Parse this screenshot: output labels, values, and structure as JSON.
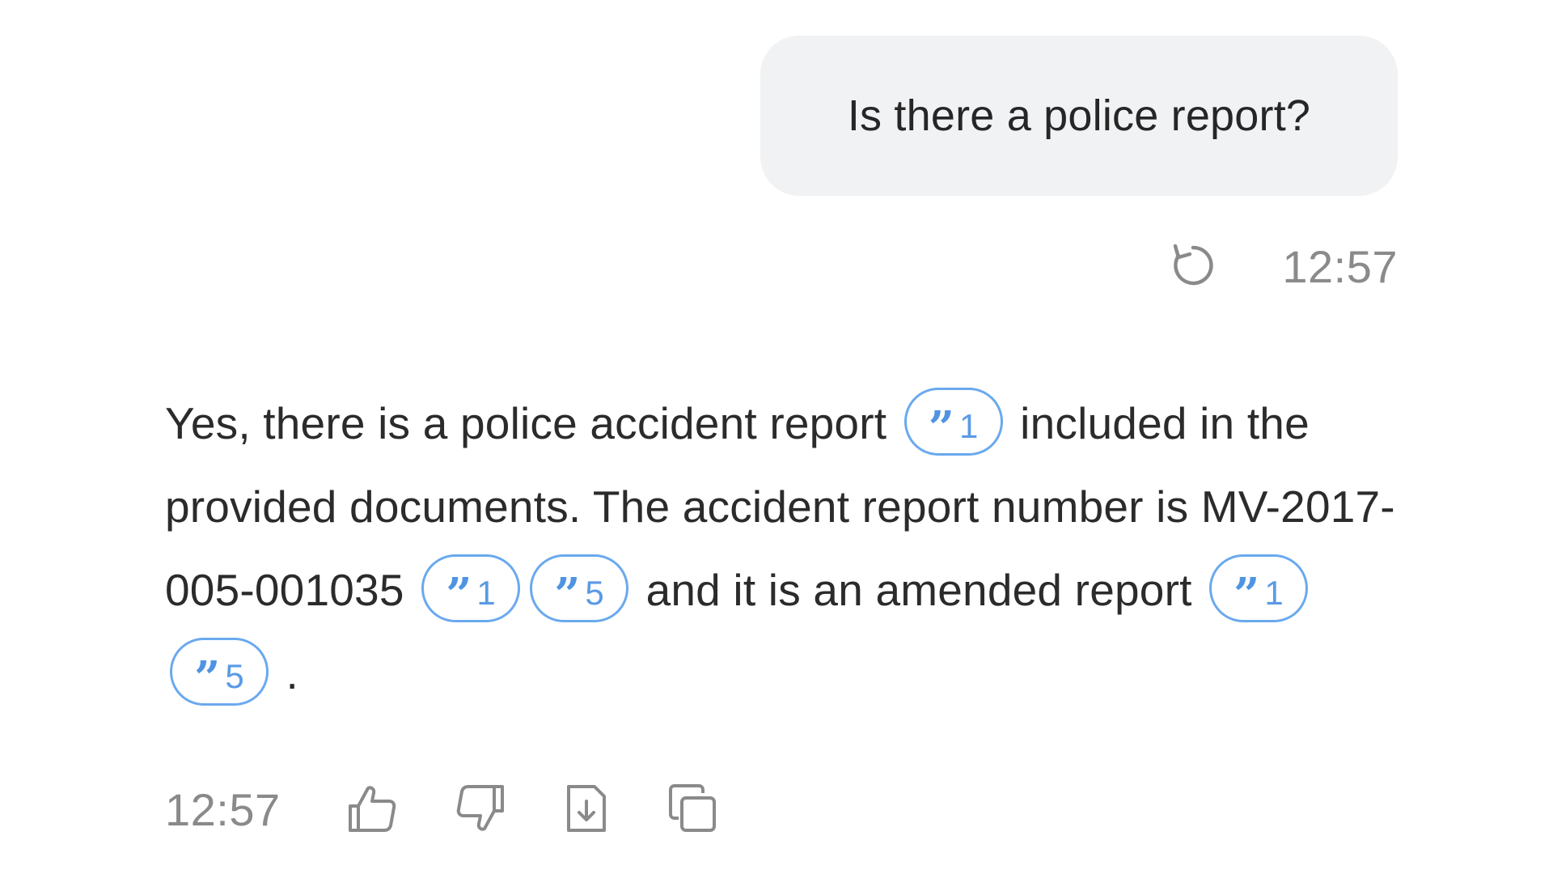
{
  "user_message": {
    "text": "Is there a police report?",
    "time": "12:57",
    "retry_icon": "retry-icon"
  },
  "assistant_message": {
    "segments": [
      {
        "type": "text",
        "value": "Yes, there is a police accident report "
      },
      {
        "type": "cite",
        "value": "1"
      },
      {
        "type": "text",
        "value": " included in the provided documents. The accident report number is MV-2017-005-001035 "
      },
      {
        "type": "cite",
        "value": "1"
      },
      {
        "type": "cite",
        "value": "5"
      },
      {
        "type": "text",
        "value": " and it is an amended report "
      },
      {
        "type": "cite",
        "value": "1"
      },
      {
        "type": "cite",
        "value": "5"
      },
      {
        "type": "text",
        "value": " ."
      }
    ],
    "time": "12:57",
    "actions": [
      "thumbs-up-icon",
      "thumbs-down-icon",
      "download-file-icon",
      "copy-icon"
    ]
  },
  "colors": {
    "bubble_bg": "#f1f2f4",
    "citation_accent": "#6aa9ee",
    "muted_text": "#8a8a8a"
  }
}
